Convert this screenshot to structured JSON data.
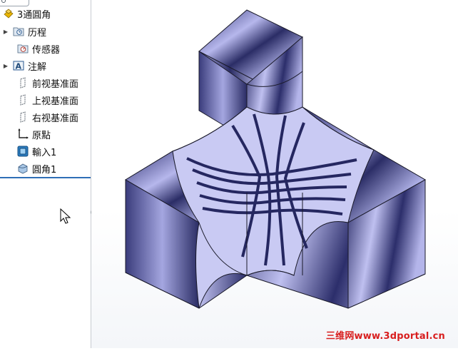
{
  "feature_tree": {
    "root": {
      "label": "3通圓角",
      "icon": "part-icon"
    },
    "items": [
      {
        "label": "历程",
        "icon": "history-icon",
        "expandable": true
      },
      {
        "label": "传感器",
        "icon": "sensor-icon",
        "expandable": false
      },
      {
        "label": "注解",
        "icon": "annotation-icon",
        "expandable": true
      },
      {
        "label": "前视基准面",
        "icon": "plane-icon",
        "expandable": false
      },
      {
        "label": "上视基准面",
        "icon": "plane-icon",
        "expandable": false
      },
      {
        "label": "右视基准面",
        "icon": "plane-icon",
        "expandable": false
      },
      {
        "label": "原點",
        "icon": "origin-icon",
        "expandable": false
      },
      {
        "label": "輸入1",
        "icon": "imported-body-icon",
        "expandable": false
      },
      {
        "label": "圓角1",
        "icon": "fillet-icon",
        "expandable": false
      }
    ]
  },
  "graphics": {
    "model_colors": {
      "dark": "#2c2e6a",
      "light": "#b8b9ec",
      "edge": "#1a1a2a"
    }
  },
  "watermark": {
    "text": "三维网www.3dportal.cn",
    "color": "#d81e1e"
  }
}
